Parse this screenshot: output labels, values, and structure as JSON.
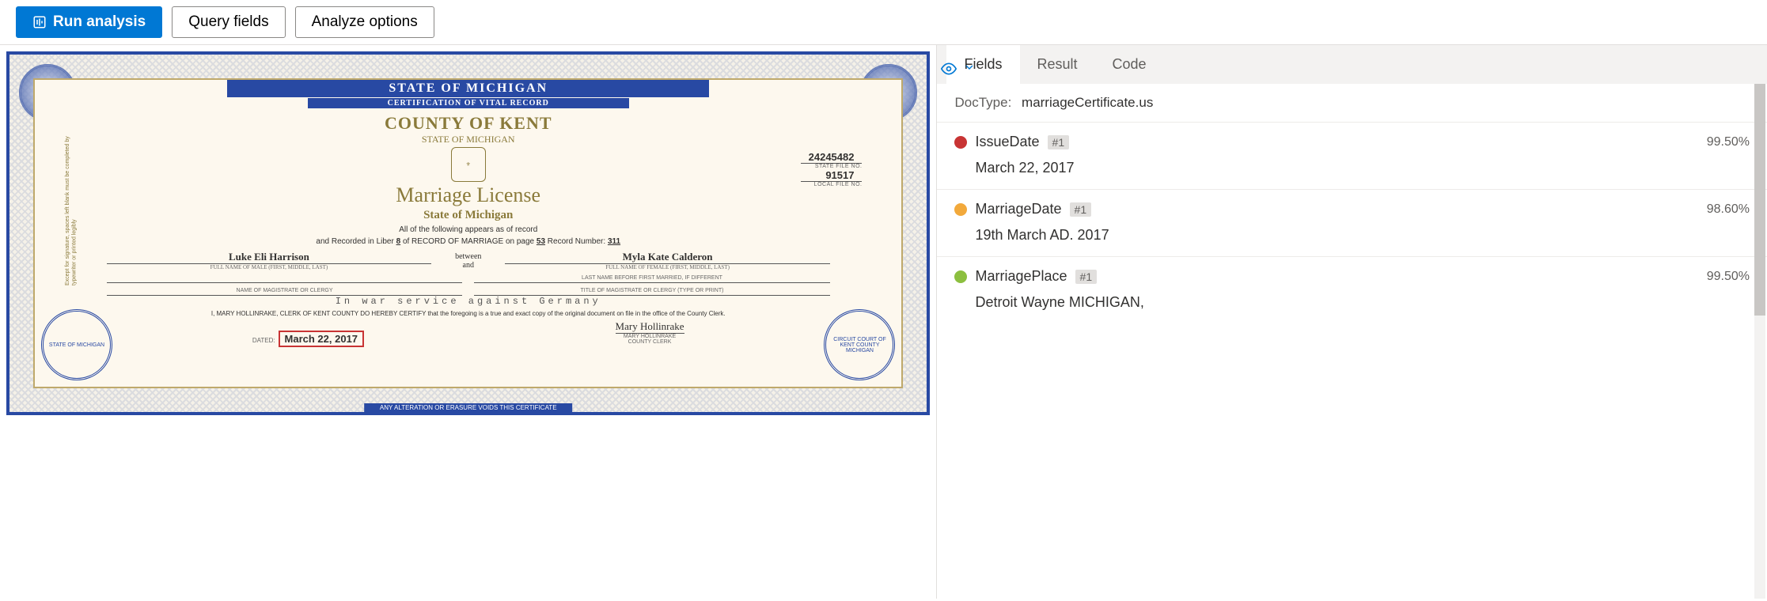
{
  "toolbar": {
    "run_label": "Run analysis",
    "query_label": "Query fields",
    "analyze_label": "Analyze options"
  },
  "certificate": {
    "banner1": "STATE OF MICHIGAN",
    "banner2": "CERTIFICATION OF VITAL RECORD",
    "county": "COUNTY OF KENT",
    "state_small": "STATE OF MICHIGAN",
    "title": "Marriage License",
    "state_medium": "State of Michigan",
    "state_file_no": "24245482",
    "state_file_lbl": "STATE FILE NO.",
    "local_file_no": "91517",
    "local_file_lbl": "LOCAL FILE NO.",
    "record_line1": "All of the following appears as of record",
    "record_line2_pre": "and Recorded in Liber",
    "liber": "8",
    "record_line2_mid": "of RECORD OF MARRIAGE on page",
    "page": "53",
    "record_line2_post": "Record Number:",
    "record_number": "311",
    "between": "between",
    "and": "and",
    "male_name": "Luke Eli Harrison",
    "male_lbl": "FULL NAME OF MALE (FIRST, MIDDLE, LAST)",
    "female_name": "Myla Kate Calderon",
    "female_lbl": "FULL NAME OF FEMALE (FIRST, MIDDLE, LAST)",
    "last_name_before_lbl": "LAST NAME BEFORE FIRST MARRIED, IF DIFFERENT",
    "magistrate_lbl": "NAME OF MAGISTRATE OR CLERGY",
    "magistrate_title_lbl": "TITLE OF MAGISTRATE OR CLERGY (TYPE OR PRINT)",
    "war_service": "In war service against Germany",
    "certify": "I, MARY HOLLINRAKE, CLERK OF KENT COUNTY DO HEREBY CERTIFY that the foregoing is a true and exact copy of the original document on file in the office of the County Clerk.",
    "dated_lbl": "DATED:",
    "dated_value": "March 22, 2017",
    "signature": "Mary Hollinrake",
    "sig_name": "MARY HOLLINRAKE",
    "sig_title": "COUNTY CLERK",
    "alter": "ANY ALTERATION OR ERASURE VOIDS THIS CERTIFICATE",
    "seal_left": "STATE OF MICHIGAN",
    "seal_right": "CIRCUIT COURT OF KENT COUNTY MICHIGAN",
    "side_text": "Except for signature, spaces left blank must be completed by typewriter or printed legibly"
  },
  "results": {
    "tabs": [
      "Fields",
      "Result",
      "Code"
    ],
    "doctype_lbl": "DocType:",
    "doctype_val": "marriageCertificate.us",
    "fields": [
      {
        "color": "red",
        "name": "IssueDate",
        "badge": "#1",
        "confidence": "99.50%",
        "value": "March 22, 2017"
      },
      {
        "color": "orange",
        "name": "MarriageDate",
        "badge": "#1",
        "confidence": "98.60%",
        "value": "19th March AD. 2017"
      },
      {
        "color": "green",
        "name": "MarriagePlace",
        "badge": "#1",
        "confidence": "99.50%",
        "value": "Detroit Wayne MICHIGAN,"
      }
    ]
  }
}
